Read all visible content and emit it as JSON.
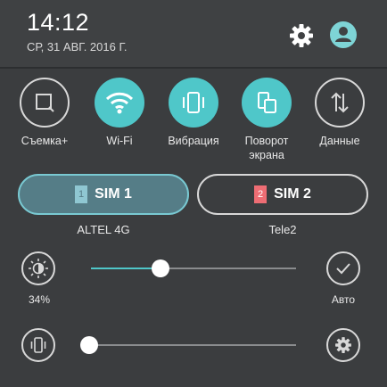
{
  "header": {
    "time": "14:12",
    "date": "СР, 31 АВГ. 2016 Г."
  },
  "toggles": [
    {
      "label": "Съемка+",
      "state": "off",
      "icon": "screenshot-icon"
    },
    {
      "label": "Wi-Fi",
      "state": "on",
      "icon": "wifi-icon"
    },
    {
      "label": "Вибрация",
      "state": "on",
      "icon": "vibrate-icon"
    },
    {
      "label": "Поворот экрана",
      "state": "on",
      "icon": "rotate-screen-icon"
    },
    {
      "label": "Данные",
      "state": "off",
      "icon": "data-transfer-icon"
    }
  ],
  "sims": [
    {
      "label": "SIM 1",
      "badge": "1",
      "carrier": "ALTEL 4G",
      "active": true,
      "color": "#8fc7d2"
    },
    {
      "label": "SIM 2",
      "badge": "2",
      "carrier": "Tele2",
      "active": false,
      "color": "#ee6d74"
    }
  ],
  "brightness": {
    "percent_label": "34%",
    "level": 0.34,
    "auto_label": "Авто"
  },
  "volume": {
    "level": 0.0
  },
  "colors": {
    "accent": "#4fc7c9",
    "background": "#3b3d3f"
  }
}
